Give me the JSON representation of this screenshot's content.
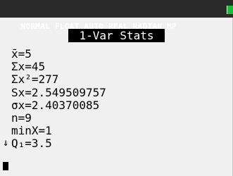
{
  "status_bar": {
    "text": "NORMAL FLOAT AUTO REAL RADIAN MP",
    "battery_color": "#1dbb3a"
  },
  "title": "1-Var Stats",
  "stats": [
    "x̄=5",
    "Σx=45",
    "Σx²=277",
    "Sx=2.549509757",
    "σx=2.40370085",
    "n=9",
    "minX=1",
    "Q₁=3.5"
  ],
  "scroll_arrow": "↓",
  "colors": {
    "screen_bg": "#f0f0f0",
    "status_bg": "#2b2b2b",
    "title_bg": "#000000",
    "text": "#000000"
  }
}
